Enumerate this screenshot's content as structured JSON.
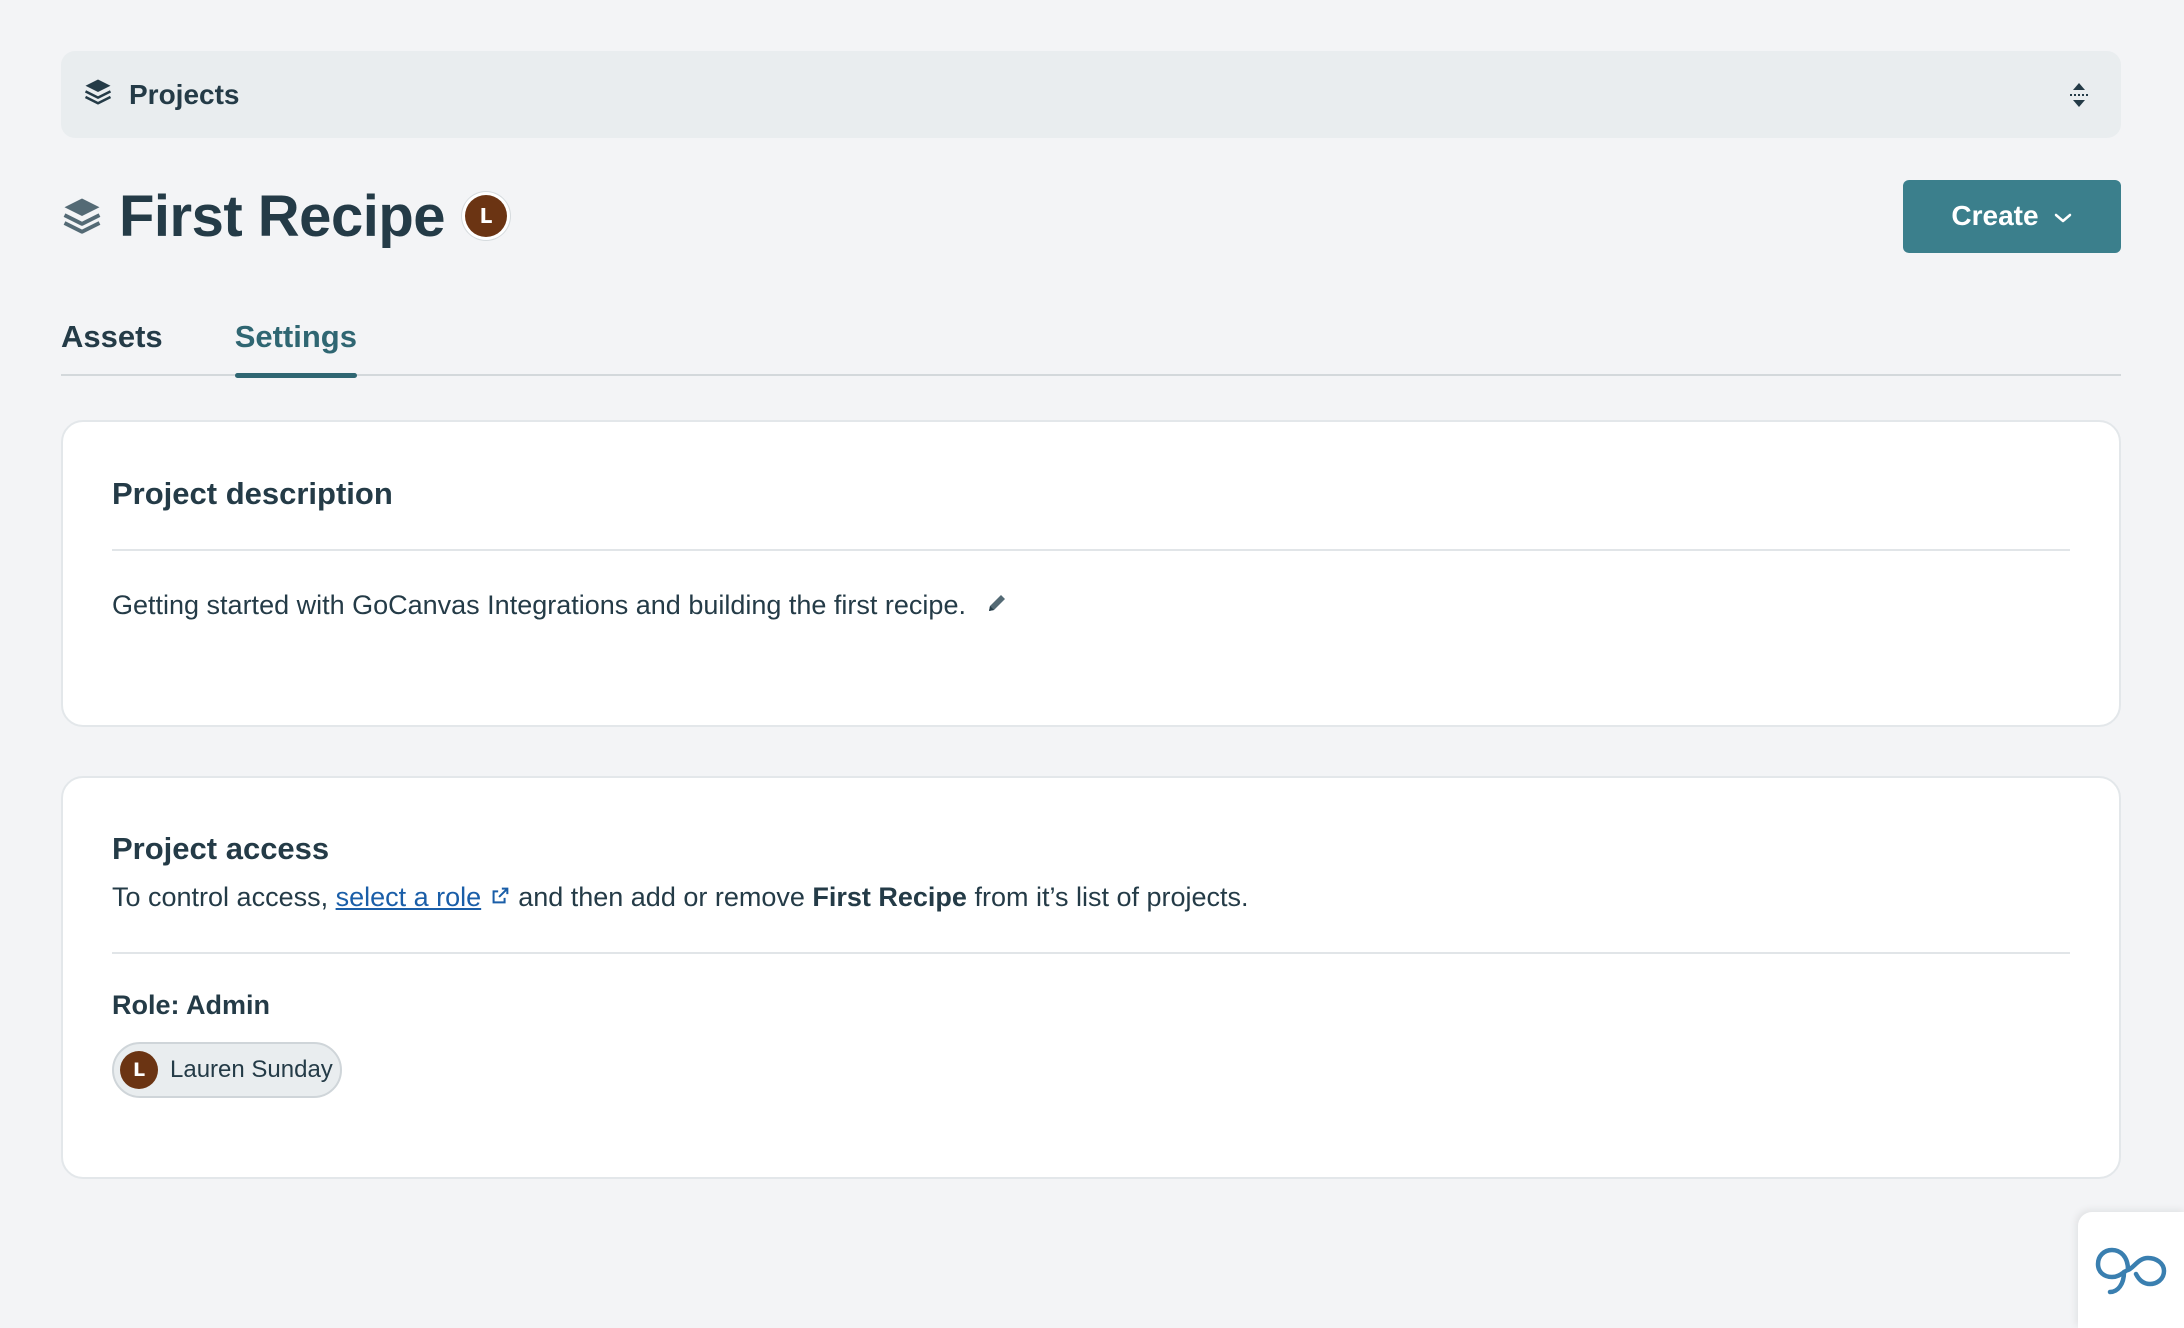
{
  "projects_bar": {
    "label": "Projects"
  },
  "header": {
    "title": "First Recipe",
    "owner_initial": "L",
    "create_label": "Create"
  },
  "tabs": [
    {
      "label": "Assets",
      "active": false
    },
    {
      "label": "Settings",
      "active": true
    }
  ],
  "description_card": {
    "title": "Project description",
    "text": "Getting started with GoCanvas Integrations and building the first recipe."
  },
  "access_card": {
    "title": "Project access",
    "text_before": "To control access, ",
    "link_label": "select a role",
    "text_middle": " and then add or remove ",
    "project_name": "First Recipe",
    "text_after": " from it’s list of projects.",
    "role_label": "Role: Admin",
    "members": [
      {
        "initial": "L",
        "name": "Lauren Sunday"
      }
    ]
  },
  "colors": {
    "primary": "#3b7f8c",
    "avatar": "#6b3413",
    "link": "#1a5ea8",
    "background": "#f3f4f6"
  },
  "icons": [
    "layers-icon",
    "expand-collapse-icon",
    "chevron-down-icon",
    "pencil-icon",
    "external-link-icon",
    "gocanvas-logo-icon"
  ]
}
